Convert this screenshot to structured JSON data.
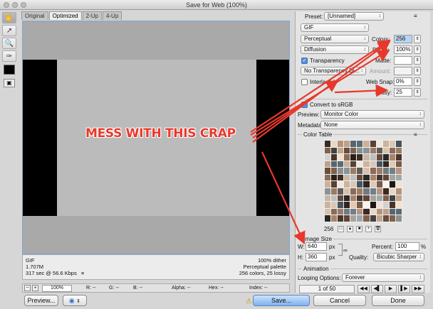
{
  "window": {
    "title": "Save for Web (100%)"
  },
  "tabs": [
    "Original",
    "Optimized",
    "2-Up",
    "4-Up"
  ],
  "info": {
    "format": "GIF",
    "size": "1.707M",
    "time": "317 sec @ 56.6 Kbps",
    "menu_glyph": "≡",
    "dither": "100% dither",
    "palette": "Perceptual palette",
    "colors_lossy": "256 colors, 25 lossy"
  },
  "statusbar": {
    "zoom": "100%",
    "r": "R: --",
    "g": "G: --",
    "b": "B: --",
    "alpha": "Alpha: --",
    "hex": "Hex: --",
    "index": "Index: --"
  },
  "bottom": {
    "preview": "Preview...",
    "save": "Save...",
    "cancel": "Cancel",
    "done": "Done",
    "warning_glyph": "⚠"
  },
  "settings": {
    "preset_label": "Preset:",
    "preset_value": "[Unnamed]",
    "format": "GIF",
    "reduction": "Perceptual",
    "dither_algorithm": "Diffusion",
    "transparency_label": "Transparency",
    "transparency_dither": "No Transparency Di...",
    "interlaced_label": "Interlaced",
    "colors_label": "Colors:",
    "colors_value": "256",
    "dither_label": "Dither:",
    "dither_value": "100%",
    "matte_label": "Matte:",
    "amount_label": "Amount:",
    "web_snap_label": "Web Snap:",
    "web_snap_value": "0%",
    "lossy_label": "Lossy:",
    "lossy_value": "25",
    "convert_srgb_label": "Convert to sRGB",
    "preview_label": "Preview:",
    "preview_value": "Monitor Color",
    "metadata_label": "Metadata:",
    "metadata_value": "None"
  },
  "color_table": {
    "label": "Color Table",
    "count": "256",
    "colors": [
      "#3a2a22",
      "#5a4032",
      "#7a5a48",
      "#8c6d5a",
      "#a8846c",
      "#c4a58c",
      "#d8c2ab",
      "#e6d7c6",
      "#f0e6da",
      "#faf4ec",
      "#2b1f19",
      "#4a352a",
      "#6a4d3d",
      "#8b6b59",
      "#b5937a",
      "#cdb39d",
      "#1e1713",
      "#3f2e24",
      "#5f4536",
      "#80604d",
      "#9f7c66",
      "#bfa18a",
      "#dcc7b4",
      "#efe3d5",
      "#c9b7a6",
      "#a6a39d",
      "#8a8f90",
      "#6f7a80",
      "#566670",
      "#445460",
      "#d3d1cc",
      "#bcc0bf",
      "#9fa8aa",
      "#88949a",
      "#70808a",
      "#5a6b76",
      "#2f241e",
      "#493529",
      "#664a39",
      "#82604c",
      "#9d7a63",
      "#b8957c",
      "#d0b095",
      "#e3c9b0",
      "#f3e0cc",
      "#2a2725",
      "#45413e",
      "#625d58"
    ]
  },
  "image_size": {
    "label": "Image Size",
    "w_label": "W:",
    "w_value": "640",
    "h_label": "H:",
    "h_value": "360",
    "unit": "px",
    "percent_label": "Percent:",
    "percent_value": "100",
    "percent_sign": "%",
    "quality_label": "Quality:",
    "quality_value": "Bicubic Sharper"
  },
  "animation": {
    "label": "Animation",
    "looping_label": "Looping Options:",
    "looping_value": "Forever",
    "frame_counter": "1 of 50"
  },
  "annotation": {
    "text": "MESS WITH THIS CRAP",
    "color": "#e8382b"
  },
  "colors": {
    "accent": "#5b8fd9",
    "annotation": "#e8382b"
  }
}
